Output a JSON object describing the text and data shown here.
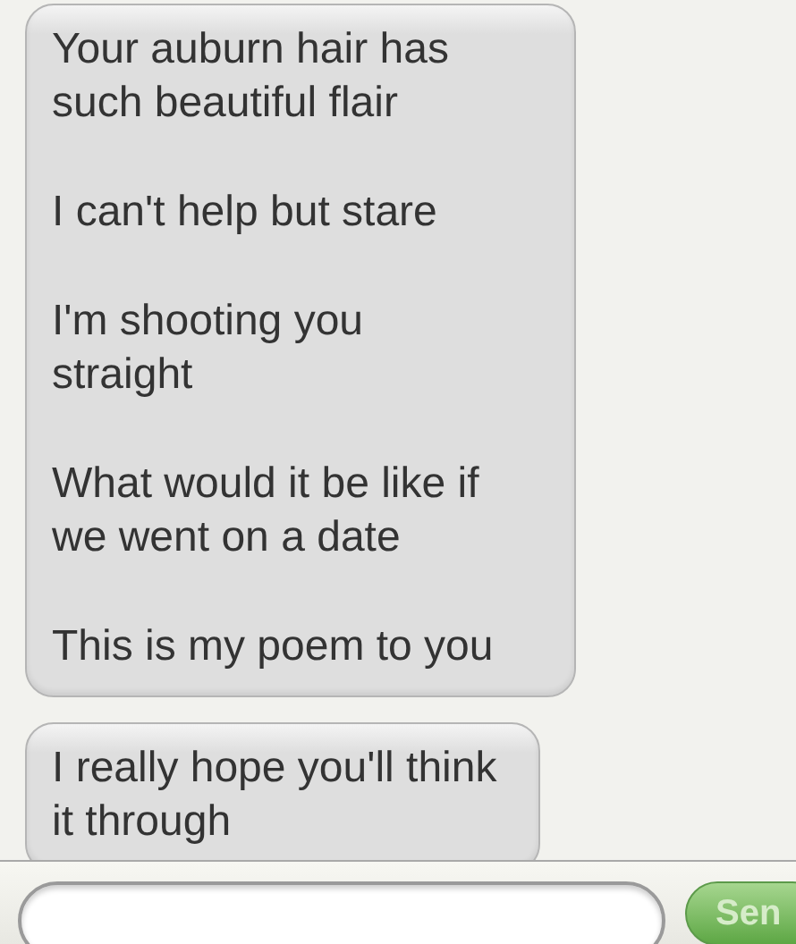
{
  "messages": [
    {
      "paragraphs": [
        "Your auburn hair has such beautiful flair",
        "I can't help but stare",
        "I'm shooting you straight",
        "What would it be like if we went on a date",
        "This is my poem to you"
      ]
    },
    {
      "paragraphs": [
        "I really hope you'll think it through"
      ]
    }
  ],
  "composer": {
    "send_button": "Sen"
  }
}
